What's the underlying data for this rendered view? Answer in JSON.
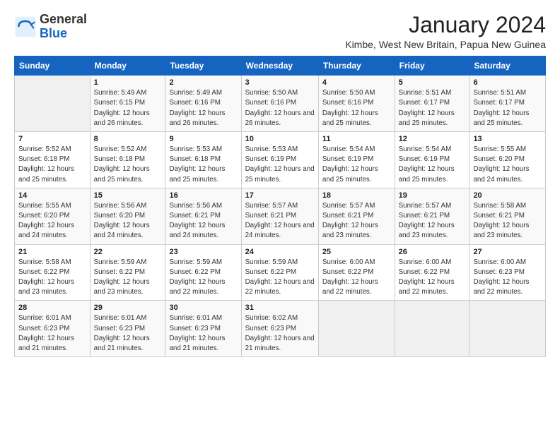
{
  "header": {
    "logo_general": "General",
    "logo_blue": "Blue",
    "month_title": "January 2024",
    "location": "Kimbe, West New Britain, Papua New Guinea"
  },
  "weekdays": [
    "Sunday",
    "Monday",
    "Tuesday",
    "Wednesday",
    "Thursday",
    "Friday",
    "Saturday"
  ],
  "weeks": [
    [
      {
        "day": "",
        "sunrise": "",
        "sunset": "",
        "daylight": ""
      },
      {
        "day": "1",
        "sunrise": "Sunrise: 5:49 AM",
        "sunset": "Sunset: 6:15 PM",
        "daylight": "Daylight: 12 hours and 26 minutes."
      },
      {
        "day": "2",
        "sunrise": "Sunrise: 5:49 AM",
        "sunset": "Sunset: 6:16 PM",
        "daylight": "Daylight: 12 hours and 26 minutes."
      },
      {
        "day": "3",
        "sunrise": "Sunrise: 5:50 AM",
        "sunset": "Sunset: 6:16 PM",
        "daylight": "Daylight: 12 hours and 26 minutes."
      },
      {
        "day": "4",
        "sunrise": "Sunrise: 5:50 AM",
        "sunset": "Sunset: 6:16 PM",
        "daylight": "Daylight: 12 hours and 25 minutes."
      },
      {
        "day": "5",
        "sunrise": "Sunrise: 5:51 AM",
        "sunset": "Sunset: 6:17 PM",
        "daylight": "Daylight: 12 hours and 25 minutes."
      },
      {
        "day": "6",
        "sunrise": "Sunrise: 5:51 AM",
        "sunset": "Sunset: 6:17 PM",
        "daylight": "Daylight: 12 hours and 25 minutes."
      }
    ],
    [
      {
        "day": "7",
        "sunrise": "Sunrise: 5:52 AM",
        "sunset": "Sunset: 6:18 PM",
        "daylight": "Daylight: 12 hours and 25 minutes."
      },
      {
        "day": "8",
        "sunrise": "Sunrise: 5:52 AM",
        "sunset": "Sunset: 6:18 PM",
        "daylight": "Daylight: 12 hours and 25 minutes."
      },
      {
        "day": "9",
        "sunrise": "Sunrise: 5:53 AM",
        "sunset": "Sunset: 6:18 PM",
        "daylight": "Daylight: 12 hours and 25 minutes."
      },
      {
        "day": "10",
        "sunrise": "Sunrise: 5:53 AM",
        "sunset": "Sunset: 6:19 PM",
        "daylight": "Daylight: 12 hours and 25 minutes."
      },
      {
        "day": "11",
        "sunrise": "Sunrise: 5:54 AM",
        "sunset": "Sunset: 6:19 PM",
        "daylight": "Daylight: 12 hours and 25 minutes."
      },
      {
        "day": "12",
        "sunrise": "Sunrise: 5:54 AM",
        "sunset": "Sunset: 6:19 PM",
        "daylight": "Daylight: 12 hours and 25 minutes."
      },
      {
        "day": "13",
        "sunrise": "Sunrise: 5:55 AM",
        "sunset": "Sunset: 6:20 PM",
        "daylight": "Daylight: 12 hours and 24 minutes."
      }
    ],
    [
      {
        "day": "14",
        "sunrise": "Sunrise: 5:55 AM",
        "sunset": "Sunset: 6:20 PM",
        "daylight": "Daylight: 12 hours and 24 minutes."
      },
      {
        "day": "15",
        "sunrise": "Sunrise: 5:56 AM",
        "sunset": "Sunset: 6:20 PM",
        "daylight": "Daylight: 12 hours and 24 minutes."
      },
      {
        "day": "16",
        "sunrise": "Sunrise: 5:56 AM",
        "sunset": "Sunset: 6:21 PM",
        "daylight": "Daylight: 12 hours and 24 minutes."
      },
      {
        "day": "17",
        "sunrise": "Sunrise: 5:57 AM",
        "sunset": "Sunset: 6:21 PM",
        "daylight": "Daylight: 12 hours and 24 minutes."
      },
      {
        "day": "18",
        "sunrise": "Sunrise: 5:57 AM",
        "sunset": "Sunset: 6:21 PM",
        "daylight": "Daylight: 12 hours and 23 minutes."
      },
      {
        "day": "19",
        "sunrise": "Sunrise: 5:57 AM",
        "sunset": "Sunset: 6:21 PM",
        "daylight": "Daylight: 12 hours and 23 minutes."
      },
      {
        "day": "20",
        "sunrise": "Sunrise: 5:58 AM",
        "sunset": "Sunset: 6:21 PM",
        "daylight": "Daylight: 12 hours and 23 minutes."
      }
    ],
    [
      {
        "day": "21",
        "sunrise": "Sunrise: 5:58 AM",
        "sunset": "Sunset: 6:22 PM",
        "daylight": "Daylight: 12 hours and 23 minutes."
      },
      {
        "day": "22",
        "sunrise": "Sunrise: 5:59 AM",
        "sunset": "Sunset: 6:22 PM",
        "daylight": "Daylight: 12 hours and 23 minutes."
      },
      {
        "day": "23",
        "sunrise": "Sunrise: 5:59 AM",
        "sunset": "Sunset: 6:22 PM",
        "daylight": "Daylight: 12 hours and 22 minutes."
      },
      {
        "day": "24",
        "sunrise": "Sunrise: 5:59 AM",
        "sunset": "Sunset: 6:22 PM",
        "daylight": "Daylight: 12 hours and 22 minutes."
      },
      {
        "day": "25",
        "sunrise": "Sunrise: 6:00 AM",
        "sunset": "Sunset: 6:22 PM",
        "daylight": "Daylight: 12 hours and 22 minutes."
      },
      {
        "day": "26",
        "sunrise": "Sunrise: 6:00 AM",
        "sunset": "Sunset: 6:22 PM",
        "daylight": "Daylight: 12 hours and 22 minutes."
      },
      {
        "day": "27",
        "sunrise": "Sunrise: 6:00 AM",
        "sunset": "Sunset: 6:23 PM",
        "daylight": "Daylight: 12 hours and 22 minutes."
      }
    ],
    [
      {
        "day": "28",
        "sunrise": "Sunrise: 6:01 AM",
        "sunset": "Sunset: 6:23 PM",
        "daylight": "Daylight: 12 hours and 21 minutes."
      },
      {
        "day": "29",
        "sunrise": "Sunrise: 6:01 AM",
        "sunset": "Sunset: 6:23 PM",
        "daylight": "Daylight: 12 hours and 21 minutes."
      },
      {
        "day": "30",
        "sunrise": "Sunrise: 6:01 AM",
        "sunset": "Sunset: 6:23 PM",
        "daylight": "Daylight: 12 hours and 21 minutes."
      },
      {
        "day": "31",
        "sunrise": "Sunrise: 6:02 AM",
        "sunset": "Sunset: 6:23 PM",
        "daylight": "Daylight: 12 hours and 21 minutes."
      },
      {
        "day": "",
        "sunrise": "",
        "sunset": "",
        "daylight": ""
      },
      {
        "day": "",
        "sunrise": "",
        "sunset": "",
        "daylight": ""
      },
      {
        "day": "",
        "sunrise": "",
        "sunset": "",
        "daylight": ""
      }
    ]
  ]
}
